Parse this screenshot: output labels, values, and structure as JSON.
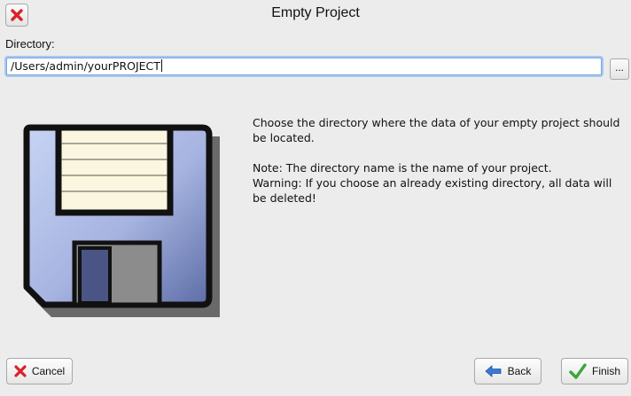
{
  "window": {
    "title": "Empty Project",
    "close_icon": "close-icon"
  },
  "directory": {
    "label": "Directory:",
    "value": "/Users/admin/yourPROJECT",
    "browse_label": "..."
  },
  "info": {
    "line1": "Choose the directory where the data of your empty project should be located.",
    "line2": "Note: The directory name is the name of your project.",
    "line3": "Warning: If you choose an already existing directory, all data will be deleted!"
  },
  "buttons": {
    "cancel": "Cancel",
    "back": "Back",
    "finish": "Finish"
  },
  "colors": {
    "cancel_red": "#d8232a",
    "finish_green": "#3aa63a",
    "back_blue": "#3b7ad6",
    "floppy_blue": "#9aa8d8"
  }
}
